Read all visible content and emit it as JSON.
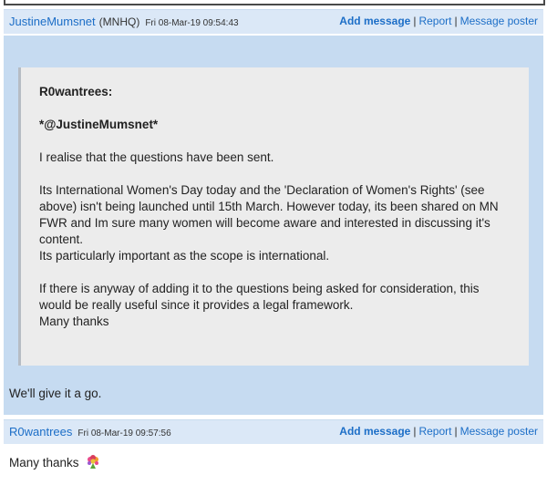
{
  "messages": [
    {
      "poster": "JustineMumsnet",
      "poster_tag": "(MNHQ)",
      "date": "Fri 08-Mar-19 09:54:43",
      "links": {
        "add": "Add message",
        "report": "Report",
        "poster": "Message poster"
      },
      "quote": {
        "author": "R0wantrees:",
        "mention": "*@JustineMumsnet*",
        "p1": "I realise that the questions have been sent.",
        "p2_lines": [
          "Its International Women's Day today and the 'Declaration of Women's Rights' (see",
          "above) isn't being launched until 15th March. However today, its been shared on MN",
          "FWR and Im sure many women will become aware and interested in discussing it's",
          "content.",
          "Its particularly important as the scope is international."
        ],
        "p3_lines": [
          "If there is anyway of adding it to the questions being asked for consideration, this",
          "would be really useful since it provides a legal framework.",
          "Many thanks"
        ]
      },
      "reply": "We'll give it a go."
    },
    {
      "poster": "R0wantrees",
      "date": "Fri 08-Mar-19 09:57:56",
      "links": {
        "add": "Add message",
        "report": "Report",
        "poster": "Message poster"
      },
      "reply": "Many thanks",
      "reply_icon": "bouquet-icon"
    }
  ],
  "separator": "|"
}
